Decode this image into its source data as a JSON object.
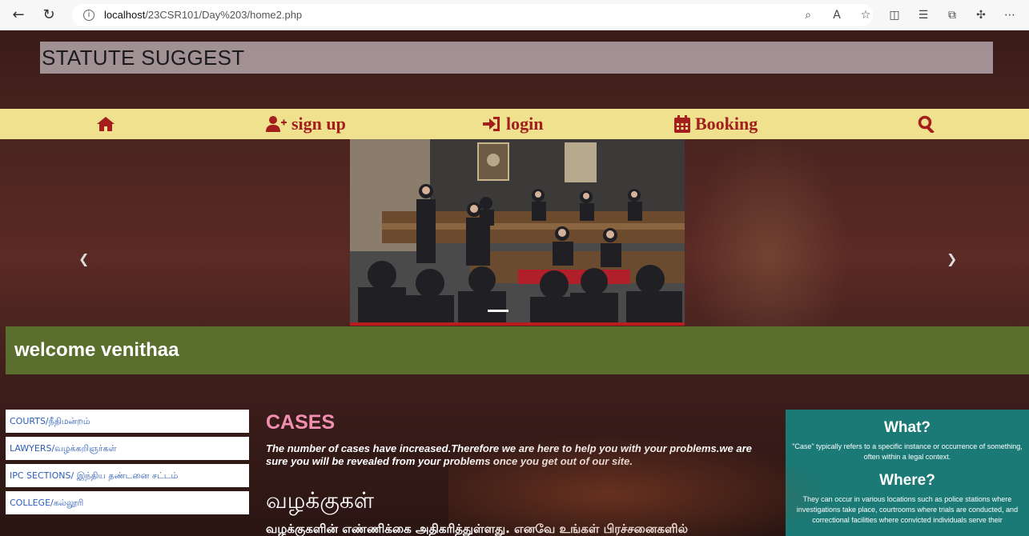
{
  "browser": {
    "url_host": "localhost",
    "url_path": "/23CSR101/Day%203/home2.php"
  },
  "site": {
    "title": "STATUTE SUGGEST"
  },
  "navbar": {
    "items": [
      {
        "icon": "home-icon",
        "label": ""
      },
      {
        "icon": "user-plus-icon",
        "label": "sign up"
      },
      {
        "icon": "sign-in-icon",
        "label": "login"
      },
      {
        "icon": "calendar-icon",
        "label": "Booking"
      },
      {
        "icon": "search-icon",
        "label": ""
      }
    ],
    "color": "#a41e1e",
    "background": "#efe18e"
  },
  "welcome": {
    "text": "welcome venithaa"
  },
  "sidebar": {
    "links": [
      {
        "label": "COURTS/நீதிமன்றம்"
      },
      {
        "label": "LAWYERS/வழக்கறிஞர்கள்"
      },
      {
        "label": "IPC SECTIONS/ இந்திய தண்டனை சட்டம்"
      },
      {
        "label": "COLLEGE/கல்லூரி"
      }
    ]
  },
  "content": {
    "heading": "CASES",
    "paragraph": "The number of cases have increased.Therefore we are here to help you with your problems.we are sure you will be revealed from your problems once you get out of our site.",
    "tamil_heading": "வழக்குகள்",
    "tamil_paragraph": "வழக்குகளின் எண்ணிக்கை அதிகரித்துள்ளது. எனவே உங்கள் பிரச்சனைகளில்"
  },
  "info": {
    "what_heading": "What?",
    "what_text": "\"Case\" typically refers to a specific instance or occurrence of something, often within a legal context.",
    "where_heading": "Where?",
    "where_text": "They can occur in various locations such as police stations where investigations take place, courtrooms where trials are conducted, and correctional facilities where convicted individuals serve their"
  },
  "colors": {
    "welcome_bar": "#5a6e2d",
    "info_box": "#1b7a76",
    "cases_heading": "#f08fb0"
  }
}
